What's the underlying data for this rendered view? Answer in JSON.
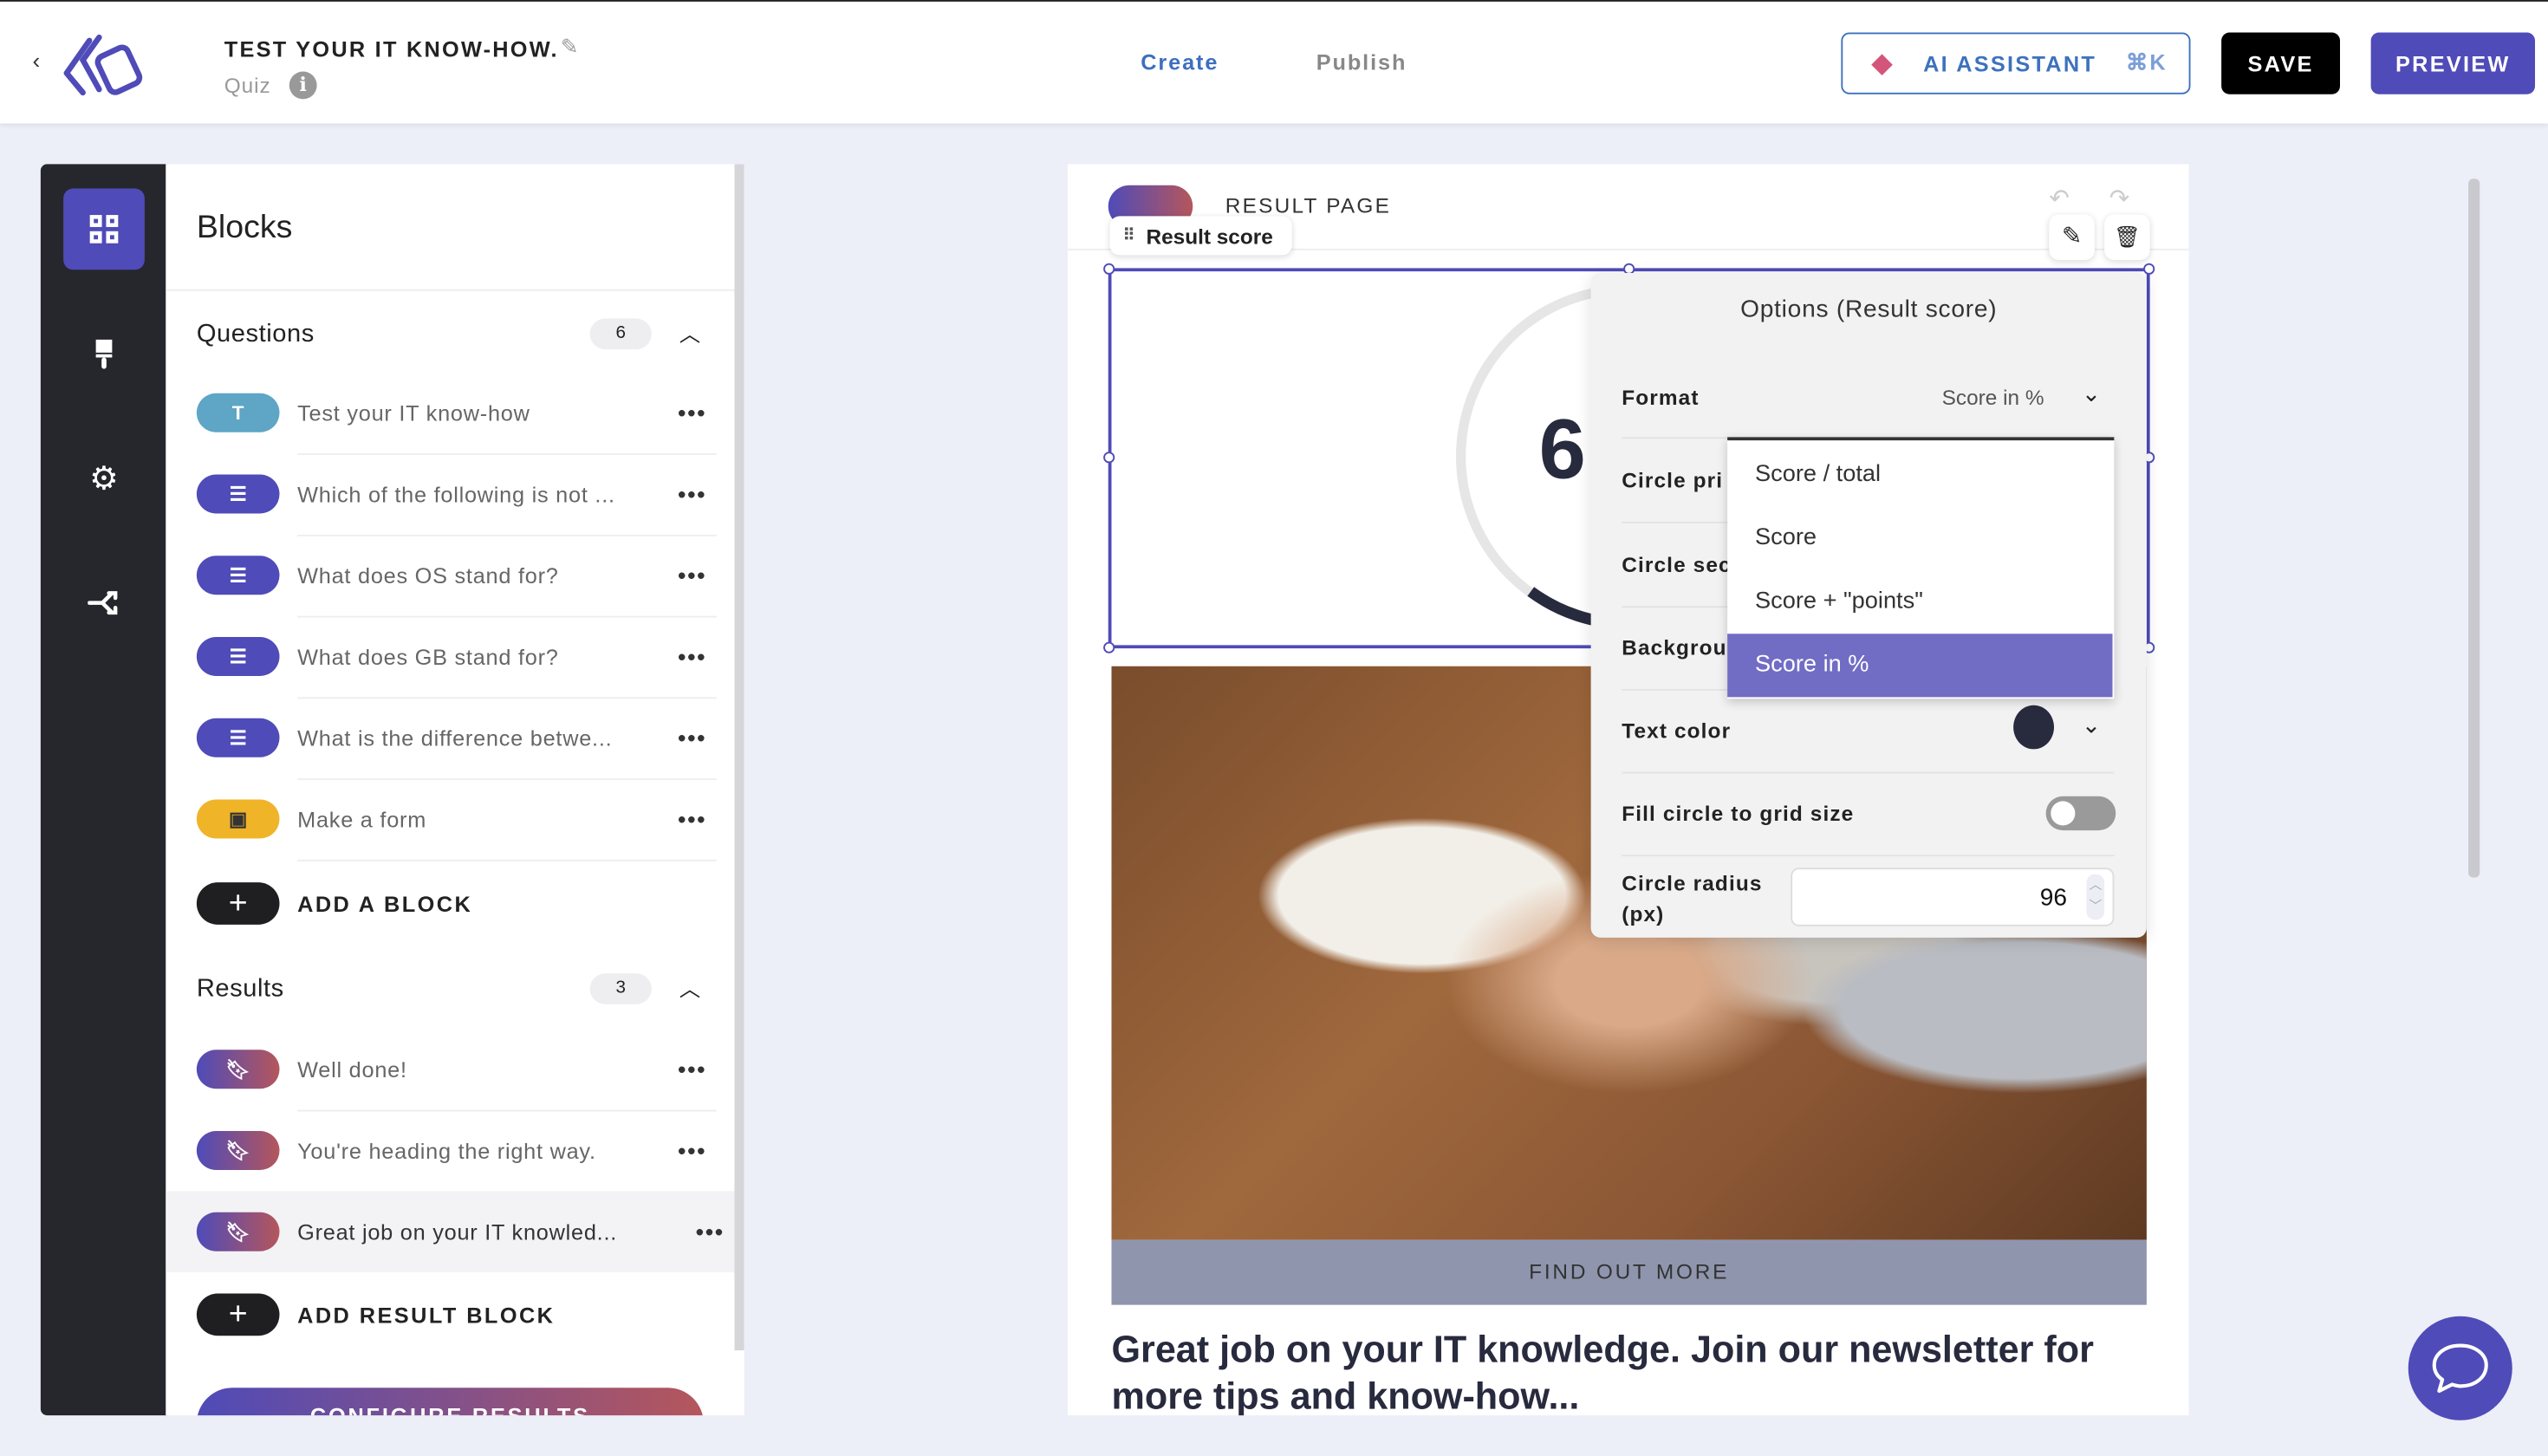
{
  "header": {
    "back_icon": "chevron-left-icon",
    "logo": "brand-logo",
    "title": "TEST YOUR IT KNOW-HOW.",
    "subtitle": "Quiz",
    "tabs": [
      {
        "label": "Create",
        "active": true
      },
      {
        "label": "Publish",
        "active": false
      }
    ],
    "ai_assistant_label": "AI ASSISTANT",
    "ai_shortcut": "⌘K",
    "save_label": "SAVE",
    "preview_label": "PREVIEW"
  },
  "colors": {
    "accent": "#4f4bb8",
    "rail": "#26272c",
    "text_pill": "#5ea5c6",
    "form_pill": "#f0b429",
    "selected_option": "#716dc5",
    "text_color_swatch": "#282a3e"
  },
  "rail": {
    "items": [
      {
        "icon": "blocks-grid-icon",
        "active": true
      },
      {
        "icon": "paint-brush-icon",
        "active": false
      },
      {
        "icon": "gear-icon",
        "active": false
      },
      {
        "icon": "flow-branch-icon",
        "active": false
      }
    ]
  },
  "blocks": {
    "title": "Blocks",
    "questions": {
      "label": "Questions",
      "count": "6",
      "items": [
        {
          "type": "text",
          "icon_text": "T",
          "label": "Test your IT know-how"
        },
        {
          "type": "list",
          "label": "Which of the following is not ..."
        },
        {
          "type": "list",
          "label": "What does OS stand for?"
        },
        {
          "type": "list",
          "label": "What does GB stand for?"
        },
        {
          "type": "list",
          "label": "What is the difference betwe..."
        },
        {
          "type": "form",
          "label": "Make a form"
        }
      ],
      "add_label": "ADD A BLOCK"
    },
    "results": {
      "label": "Results",
      "count": "3",
      "items": [
        {
          "label": "Well done!"
        },
        {
          "label": "You're heading the right way."
        },
        {
          "label": "Great job on your IT knowled...",
          "selected": true
        }
      ],
      "add_label": "ADD RESULT BLOCK"
    },
    "configure_label": "CONFIGURE RESULTS"
  },
  "canvas": {
    "page_label": "RESULT PAGE",
    "block_tag": "Result score",
    "score_partial": "6",
    "cta_label": "FIND OUT MORE",
    "heading": "Great job on your IT knowledge. Join our newsletter for more tips and know-how..."
  },
  "options": {
    "title": "Options (Result score)",
    "format_label": "Format",
    "format_value": "Score in %",
    "rows": [
      "Circle pri",
      "Circle sec",
      "Backgrou"
    ],
    "text_color_label": "Text color",
    "fill_label": "Fill circle to grid size",
    "fill_on": false,
    "radius_label": "Circle radius (px)",
    "radius_value": "96"
  },
  "format_dropdown": {
    "options": [
      "Score / total",
      "Score",
      "Score + \"points\"",
      "Score in %"
    ],
    "selected": "Score in %"
  },
  "chat_icon": "chat-bubble-icon"
}
